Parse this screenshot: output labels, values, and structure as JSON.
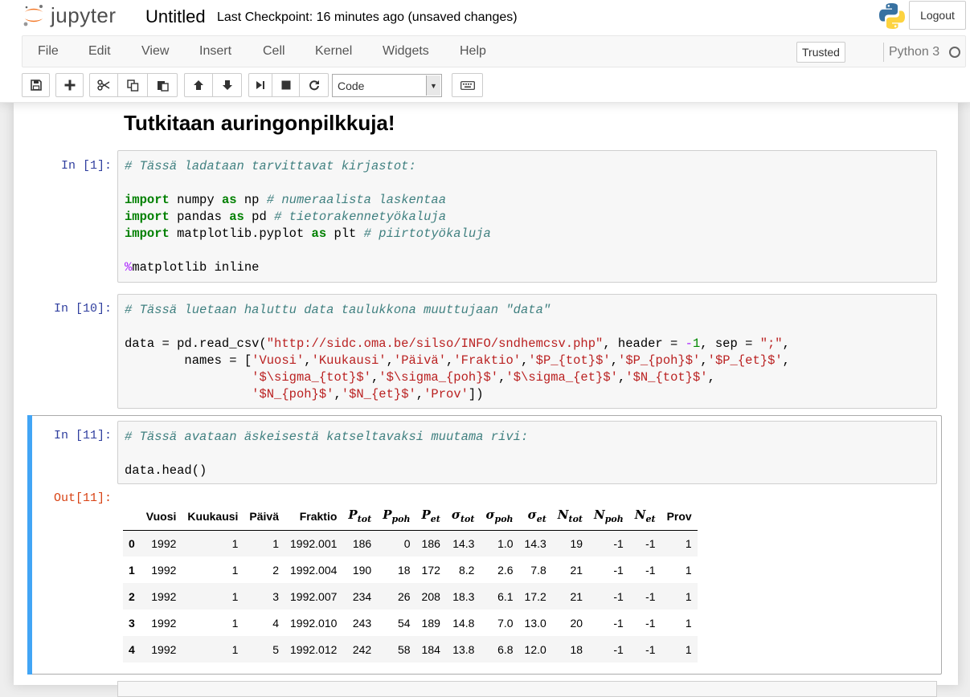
{
  "header": {
    "logo_text": "jupyter",
    "notebook_title": "Untitled",
    "checkpoint": "Last Checkpoint: 16 minutes ago (unsaved changes)",
    "logout_label": "Logout"
  },
  "menu": {
    "items": [
      "File",
      "Edit",
      "View",
      "Insert",
      "Cell",
      "Kernel",
      "Widgets",
      "Help"
    ],
    "trusted_label": "Trusted",
    "kernel_name": "Python 3"
  },
  "toolbar": {
    "cell_type": "Code"
  },
  "notebook": {
    "markdown_heading": "Tutkitaan auringonpilkkuja!",
    "cells": [
      {
        "prompt": "In [1]:",
        "lines": [
          "# Tässä ladataan tarvittavat kirjastot:",
          "",
          "import numpy as np # numeraalista laskentaa",
          "import pandas as pd # tietorakennetyökaluja",
          "import matplotlib.pyplot as plt # piirtotyökaluja",
          "",
          "%matplotlib inline"
        ]
      },
      {
        "prompt": "In [10]:",
        "lines": [
          "# Tässä luetaan haluttu data taulukkona muuttujaan \"data\"",
          "",
          "data = pd.read_csv(\"http://sidc.oma.be/silso/INFO/sndhemcsv.php\", header = -1, sep = \";\",",
          "        names = ['Vuosi','Kuukausi','Päivä','Fraktio','$P_{tot}$','$P_{poh}$','$P_{et}$',",
          "                 '$\\sigma_{tot}$','$\\sigma_{poh}$','$\\sigma_{et}$','$N_{tot}$',",
          "                 '$N_{poh}$','$N_{et}$','Prov'])"
        ]
      },
      {
        "prompt": "In [11]:",
        "out_prompt": "Out[11]:",
        "lines": [
          "# Tässä avataan äskeisestä katseltavaksi muutama rivi:",
          "",
          "data.head()"
        ]
      }
    ],
    "table": {
      "plain_headers": [
        "Vuosi",
        "Kuukausi",
        "Päivä",
        "Fraktio"
      ],
      "math_headers": [
        {
          "base": "P",
          "sub": "tot"
        },
        {
          "base": "P",
          "sub": "poh"
        },
        {
          "base": "P",
          "sub": "et"
        },
        {
          "base": "σ",
          "sub": "tot"
        },
        {
          "base": "σ",
          "sub": "poh"
        },
        {
          "base": "σ",
          "sub": "et"
        },
        {
          "base": "N",
          "sub": "tot"
        },
        {
          "base": "N",
          "sub": "poh"
        },
        {
          "base": "N",
          "sub": "et"
        }
      ],
      "last_header": "Prov",
      "rows": [
        [
          "0",
          "1992",
          "1",
          "1",
          "1992.001",
          "186",
          "0",
          "186",
          "14.3",
          "1.0",
          "14.3",
          "19",
          "-1",
          "-1",
          "1"
        ],
        [
          "1",
          "1992",
          "1",
          "2",
          "1992.004",
          "190",
          "18",
          "172",
          "8.2",
          "2.6",
          "7.8",
          "21",
          "-1",
          "-1",
          "1"
        ],
        [
          "2",
          "1992",
          "1",
          "3",
          "1992.007",
          "234",
          "26",
          "208",
          "18.3",
          "6.1",
          "17.2",
          "21",
          "-1",
          "-1",
          "1"
        ],
        [
          "3",
          "1992",
          "1",
          "4",
          "1992.010",
          "243",
          "54",
          "189",
          "14.8",
          "7.0",
          "13.0",
          "20",
          "-1",
          "-1",
          "1"
        ],
        [
          "4",
          "1992",
          "1",
          "5",
          "1992.012",
          "242",
          "58",
          "184",
          "13.8",
          "6.8",
          "12.0",
          "18",
          "-1",
          "-1",
          "1"
        ]
      ]
    }
  },
  "colors": {
    "selected_cell_bar": "#42a5f5",
    "in_prompt": "#303f9f",
    "out_prompt": "#d84315",
    "comment": "#408080",
    "keyword": "#008000",
    "string": "#ba2121"
  }
}
